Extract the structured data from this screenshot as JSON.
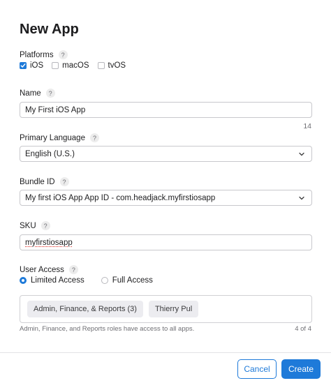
{
  "dialog": {
    "title": "New App"
  },
  "platforms": {
    "label": "Platforms",
    "help": "?",
    "options": [
      {
        "label": "iOS",
        "checked": true
      },
      {
        "label": "macOS",
        "checked": false
      },
      {
        "label": "tvOS",
        "checked": false
      }
    ]
  },
  "name": {
    "label": "Name",
    "help": "?",
    "value": "My First iOS App",
    "remaining": "14"
  },
  "primary_language": {
    "label": "Primary Language",
    "help": "?",
    "value": "English (U.S.)"
  },
  "bundle_id": {
    "label": "Bundle ID",
    "help": "?",
    "value": "My first iOS App App ID - com.headjack.myfirstiosapp"
  },
  "sku": {
    "label": "SKU",
    "help": "?",
    "value": "myfirstiosapp"
  },
  "user_access": {
    "label": "User Access",
    "help": "?",
    "options": [
      {
        "label": "Limited Access",
        "selected": true
      },
      {
        "label": "Full Access",
        "selected": false
      }
    ],
    "chips": [
      "Admin, Finance, & Reports (3)",
      "Thierry Pul"
    ],
    "helper_text": "Admin, Finance, and Reports roles have access to all apps.",
    "count": "4 of 4"
  },
  "footer": {
    "cancel_label": "Cancel",
    "create_label": "Create"
  },
  "colors": {
    "accent": "#1e7ad9",
    "border": "#c8c8cc",
    "muted_text": "#6e6e73"
  }
}
